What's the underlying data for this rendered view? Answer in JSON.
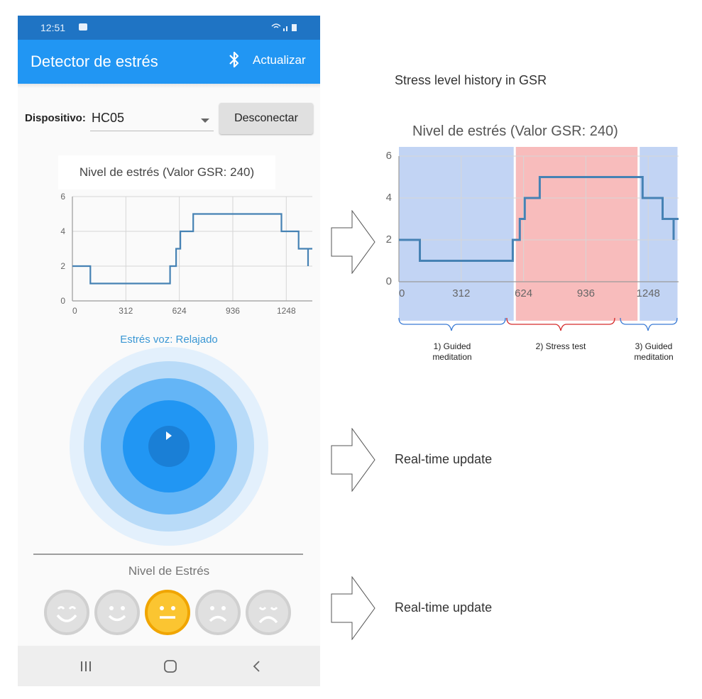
{
  "status_bar": {
    "time": "12:51",
    "system_icons": "wifi-signal-battery"
  },
  "app_bar": {
    "title": "Detector de estrés",
    "bluetooth_icon": "bluetooth-icon",
    "refresh_label": "Actualizar"
  },
  "device": {
    "label": "Dispositivo:",
    "selected": "HC05",
    "disconnect_label": "Desconectar"
  },
  "chart": {
    "title": "Nivel de estrés (Valor GSR: 240)"
  },
  "voice_status": "Estrés voz: Relajado",
  "stress_level": {
    "label": "Nivel de Estrés",
    "faces": [
      "very-happy-face-icon",
      "happy-face-icon",
      "neutral-face-icon",
      "sad-face-icon",
      "very-sad-face-icon"
    ],
    "selected_index": 2
  },
  "nav": [
    "recents-icon",
    "home-icon",
    "back-icon"
  ],
  "annotations": {
    "history_title": "Stress level history in GSR",
    "phase_1": "1) Guided meditation",
    "phase_2": "2) Stress test",
    "phase_3": "3)  Guided meditation",
    "realtime_1": "Real-time update",
    "realtime_2": "Real-time update"
  },
  "colors": {
    "app_bar": "#2196f3",
    "status_bar": "#1f74c4",
    "line": "#4682b4",
    "meditation_band": "#aec6f0",
    "stress_band": "#f6a5a5",
    "active_face": "#fbc531"
  },
  "chart_data": {
    "type": "line",
    "title": "Nivel de estrés (Valor GSR: 240)",
    "xlabel": "",
    "ylabel": "",
    "x_ticks": [
      0,
      312,
      624,
      936,
      1248
    ],
    "y_ticks": [
      0,
      2,
      4,
      6
    ],
    "xlim": [
      0,
      1400
    ],
    "ylim": [
      0,
      6
    ],
    "grid": true,
    "points": [
      [
        0,
        2
      ],
      [
        105,
        2
      ],
      [
        105,
        1
      ],
      [
        570,
        1
      ],
      [
        570,
        2
      ],
      [
        605,
        2
      ],
      [
        605,
        3
      ],
      [
        630,
        3
      ],
      [
        630,
        4
      ],
      [
        705,
        4
      ],
      [
        705,
        5
      ],
      [
        1220,
        5
      ],
      [
        1220,
        4
      ],
      [
        1320,
        4
      ],
      [
        1320,
        3
      ],
      [
        1375,
        3
      ],
      [
        1375,
        2
      ],
      [
        1375,
        3
      ],
      [
        1400,
        3
      ]
    ],
    "regions": [
      {
        "label": "1) Guided meditation",
        "x": [
          0,
          580
        ]
      },
      {
        "label": "2) Stress test",
        "x": [
          580,
          1200
        ]
      },
      {
        "label": "3)  Guided meditation",
        "x": [
          1200,
          1400
        ]
      }
    ]
  }
}
